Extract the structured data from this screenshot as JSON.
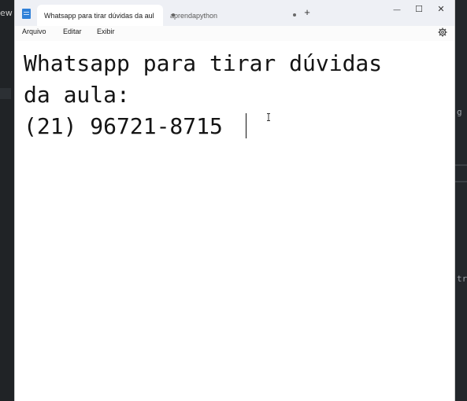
{
  "background": {
    "left_text": "ew",
    "right_texts": [
      "g",
      "tr"
    ]
  },
  "window": {
    "tabs": [
      {
        "label": "Whatsapp para tirar dúvidas da aul",
        "active": true
      },
      {
        "label": "aprendapython",
        "active": false
      }
    ],
    "new_tab_symbol": "+",
    "controls": {
      "minimize": "—",
      "maximize": "☐",
      "close": "✕"
    },
    "menu": [
      "Arquivo",
      "Editar",
      "Exibir"
    ],
    "settings_icon": "gear-icon"
  },
  "document": {
    "lines": [
      "Whatsapp para tirar dúvidas",
      "da aula:",
      "(21) 96721-8715"
    ]
  },
  "colors": {
    "titlebar": "#eef0f5",
    "app_icon": "#2f80d8",
    "editor_bg": "#ffffff"
  }
}
